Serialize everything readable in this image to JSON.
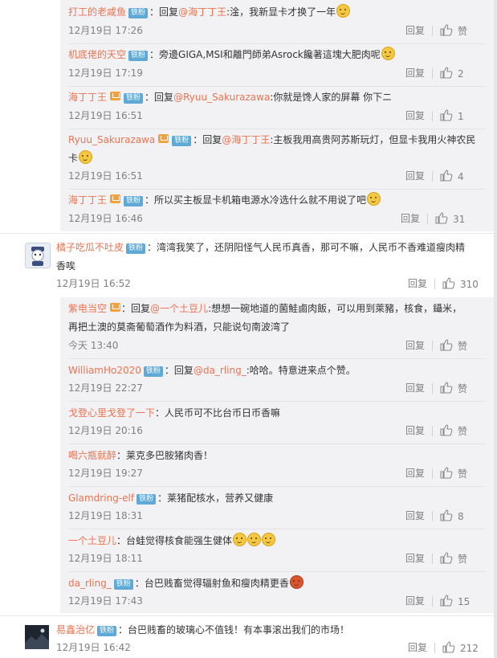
{
  "badge_label": "铁粉",
  "reply_label": "回复",
  "c1": {
    "user": "打工的老咸鱼",
    "sep": "：",
    "pre": "回复",
    "mention": "@海丁丁王",
    "body": ":淦，我新显卡才换了一年",
    "time": "12月19日 17:26",
    "likes": "赞"
  },
  "c2": {
    "user": "机底佬的天空",
    "sep": "：",
    "body": "旁邊GIGA,MSI和離門師弟Asrock饞著這塊大肥肉呢",
    "time": "12月19日 17:19",
    "likes": "2"
  },
  "c3": {
    "user": "海丁丁王",
    "sep": "：",
    "pre": "回复",
    "mention": "@Ryuu_Sakurazawa",
    "body": ":你就是馋人家的屏幕 你下ニ",
    "time": "12月19日 16:51",
    "likes": "1"
  },
  "c4": {
    "user": "Ryuu_Sakurazawa",
    "sep": "：",
    "pre": "回复",
    "mention": "@海丁丁王",
    "body": ":主板我用高贵阿苏斯玩灯，但显卡我用火神农民",
    "body2": "卡",
    "time": "12月19日 16:51",
    "likes": "4"
  },
  "c5": {
    "user": "海丁丁王",
    "sep": "：",
    "body": "所以买主板显卡机箱电源水冷选什么就不用说了吧",
    "time": "12月19日 16:46",
    "likes": "31"
  },
  "m1": {
    "user": "橘子吃瓜不吐皮",
    "sep": "：",
    "body": "湾湾我笑了，还阴阳怪气人民币真香，那可不嘛，人民币不香难道瘦肉精",
    "body2": "香唉",
    "time": "12月19日 16:52",
    "likes": "310"
  },
  "r1": {
    "user": "紫电当空",
    "sep": "：",
    "pre": "回复",
    "mention": "@一个土豆儿",
    "body": ":想想一碗地道的菌鮭鹵肉飯，可以用到萊豬，核食，鑷米，",
    "body2": "再把土澳的莫斋葡萄酒作为料酒，只能说句南波湾了",
    "time": "今天 13:40",
    "likes": "赞"
  },
  "r2": {
    "user": "WilliamHo2020",
    "sep": "：",
    "pre": "回复",
    "mention": "@da_rling_",
    "body": ":哈哈。特意进来点个赞。",
    "time": "12月19日 22:27",
    "likes": "赞"
  },
  "r3": {
    "user": "戈登心里戈登了一下",
    "sep": "：",
    "body": "人民币可不比台币日币香嘛",
    "time": "12月19日 20:16",
    "likes": "赞"
  },
  "r4": {
    "user": "喝六瓶就醉",
    "sep": "：",
    "body": "莱克多巴胺猪肉香！",
    "time": "12月19日 19:27",
    "likes": "赞"
  },
  "r5": {
    "user": "Glamdring-elf",
    "sep": "：",
    "body": "莱猪配核水，营养又健康",
    "time": "12月19日 18:31",
    "likes": "8"
  },
  "r6": {
    "user": "一个土豆儿",
    "sep": "：",
    "body": "台蛙觉得核食能强生健体",
    "time": "12月19日 18:11",
    "likes": "赞"
  },
  "r7": {
    "user": "da_rling_",
    "sep": "：",
    "body": "台巴贱畜觉得辐射鱼和瘦肉精更香",
    "time": "12月19日 17:43",
    "likes": "15"
  },
  "m2": {
    "user": "易鑫治亿",
    "sep": "：",
    "body": "台巴贱畜的玻璃心不值钱！有本事滚出我们的市场！",
    "time": "12月19日 16:42",
    "likes": "212"
  }
}
